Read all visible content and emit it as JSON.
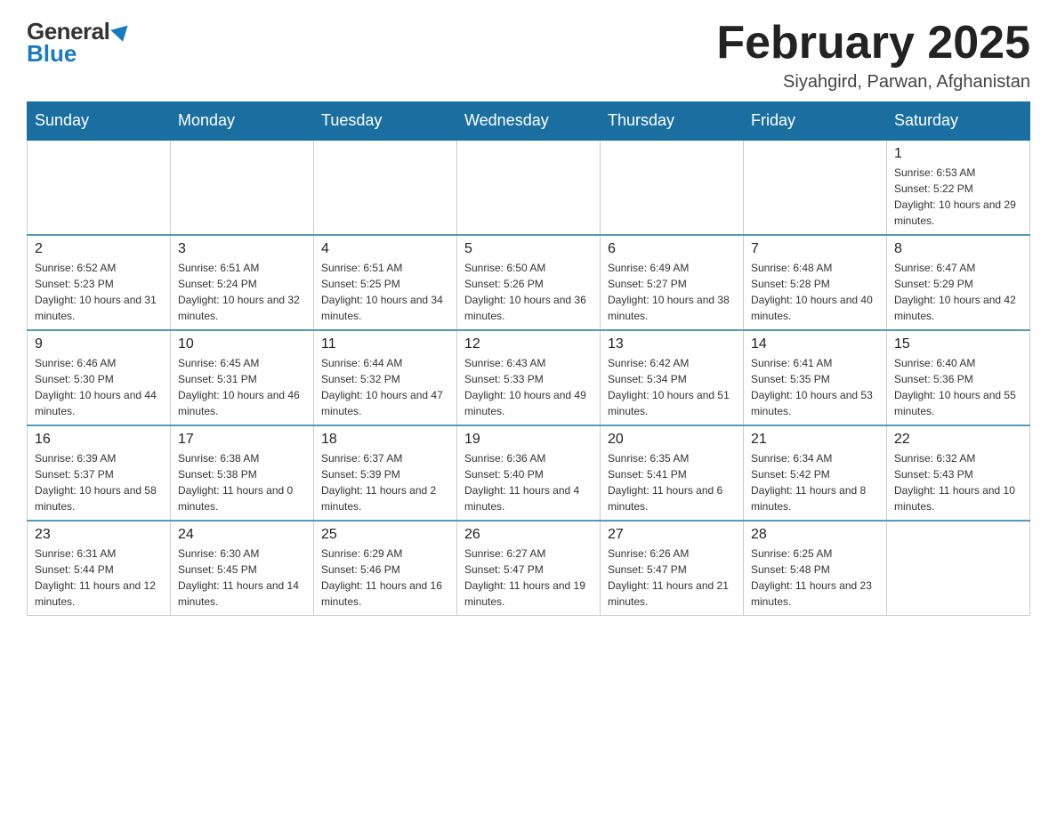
{
  "header": {
    "logo": {
      "general_text": "General",
      "blue_text": "Blue"
    },
    "title": "February 2025",
    "subtitle": "Siyahgird, Parwan, Afghanistan"
  },
  "calendar": {
    "weekdays": [
      "Sunday",
      "Monday",
      "Tuesday",
      "Wednesday",
      "Thursday",
      "Friday",
      "Saturday"
    ],
    "weeks": [
      [
        {
          "day": "",
          "sunrise": "",
          "sunset": "",
          "daylight": "",
          "empty": true
        },
        {
          "day": "",
          "sunrise": "",
          "sunset": "",
          "daylight": "",
          "empty": true
        },
        {
          "day": "",
          "sunrise": "",
          "sunset": "",
          "daylight": "",
          "empty": true
        },
        {
          "day": "",
          "sunrise": "",
          "sunset": "",
          "daylight": "",
          "empty": true
        },
        {
          "day": "",
          "sunrise": "",
          "sunset": "",
          "daylight": "",
          "empty": true
        },
        {
          "day": "",
          "sunrise": "",
          "sunset": "",
          "daylight": "",
          "empty": true
        },
        {
          "day": "1",
          "sunrise": "Sunrise: 6:53 AM",
          "sunset": "Sunset: 5:22 PM",
          "daylight": "Daylight: 10 hours and 29 minutes.",
          "empty": false
        }
      ],
      [
        {
          "day": "2",
          "sunrise": "Sunrise: 6:52 AM",
          "sunset": "Sunset: 5:23 PM",
          "daylight": "Daylight: 10 hours and 31 minutes.",
          "empty": false
        },
        {
          "day": "3",
          "sunrise": "Sunrise: 6:51 AM",
          "sunset": "Sunset: 5:24 PM",
          "daylight": "Daylight: 10 hours and 32 minutes.",
          "empty": false
        },
        {
          "day": "4",
          "sunrise": "Sunrise: 6:51 AM",
          "sunset": "Sunset: 5:25 PM",
          "daylight": "Daylight: 10 hours and 34 minutes.",
          "empty": false
        },
        {
          "day": "5",
          "sunrise": "Sunrise: 6:50 AM",
          "sunset": "Sunset: 5:26 PM",
          "daylight": "Daylight: 10 hours and 36 minutes.",
          "empty": false
        },
        {
          "day": "6",
          "sunrise": "Sunrise: 6:49 AM",
          "sunset": "Sunset: 5:27 PM",
          "daylight": "Daylight: 10 hours and 38 minutes.",
          "empty": false
        },
        {
          "day": "7",
          "sunrise": "Sunrise: 6:48 AM",
          "sunset": "Sunset: 5:28 PM",
          "daylight": "Daylight: 10 hours and 40 minutes.",
          "empty": false
        },
        {
          "day": "8",
          "sunrise": "Sunrise: 6:47 AM",
          "sunset": "Sunset: 5:29 PM",
          "daylight": "Daylight: 10 hours and 42 minutes.",
          "empty": false
        }
      ],
      [
        {
          "day": "9",
          "sunrise": "Sunrise: 6:46 AM",
          "sunset": "Sunset: 5:30 PM",
          "daylight": "Daylight: 10 hours and 44 minutes.",
          "empty": false
        },
        {
          "day": "10",
          "sunrise": "Sunrise: 6:45 AM",
          "sunset": "Sunset: 5:31 PM",
          "daylight": "Daylight: 10 hours and 46 minutes.",
          "empty": false
        },
        {
          "day": "11",
          "sunrise": "Sunrise: 6:44 AM",
          "sunset": "Sunset: 5:32 PM",
          "daylight": "Daylight: 10 hours and 47 minutes.",
          "empty": false
        },
        {
          "day": "12",
          "sunrise": "Sunrise: 6:43 AM",
          "sunset": "Sunset: 5:33 PM",
          "daylight": "Daylight: 10 hours and 49 minutes.",
          "empty": false
        },
        {
          "day": "13",
          "sunrise": "Sunrise: 6:42 AM",
          "sunset": "Sunset: 5:34 PM",
          "daylight": "Daylight: 10 hours and 51 minutes.",
          "empty": false
        },
        {
          "day": "14",
          "sunrise": "Sunrise: 6:41 AM",
          "sunset": "Sunset: 5:35 PM",
          "daylight": "Daylight: 10 hours and 53 minutes.",
          "empty": false
        },
        {
          "day": "15",
          "sunrise": "Sunrise: 6:40 AM",
          "sunset": "Sunset: 5:36 PM",
          "daylight": "Daylight: 10 hours and 55 minutes.",
          "empty": false
        }
      ],
      [
        {
          "day": "16",
          "sunrise": "Sunrise: 6:39 AM",
          "sunset": "Sunset: 5:37 PM",
          "daylight": "Daylight: 10 hours and 58 minutes.",
          "empty": false
        },
        {
          "day": "17",
          "sunrise": "Sunrise: 6:38 AM",
          "sunset": "Sunset: 5:38 PM",
          "daylight": "Daylight: 11 hours and 0 minutes.",
          "empty": false
        },
        {
          "day": "18",
          "sunrise": "Sunrise: 6:37 AM",
          "sunset": "Sunset: 5:39 PM",
          "daylight": "Daylight: 11 hours and 2 minutes.",
          "empty": false
        },
        {
          "day": "19",
          "sunrise": "Sunrise: 6:36 AM",
          "sunset": "Sunset: 5:40 PM",
          "daylight": "Daylight: 11 hours and 4 minutes.",
          "empty": false
        },
        {
          "day": "20",
          "sunrise": "Sunrise: 6:35 AM",
          "sunset": "Sunset: 5:41 PM",
          "daylight": "Daylight: 11 hours and 6 minutes.",
          "empty": false
        },
        {
          "day": "21",
          "sunrise": "Sunrise: 6:34 AM",
          "sunset": "Sunset: 5:42 PM",
          "daylight": "Daylight: 11 hours and 8 minutes.",
          "empty": false
        },
        {
          "day": "22",
          "sunrise": "Sunrise: 6:32 AM",
          "sunset": "Sunset: 5:43 PM",
          "daylight": "Daylight: 11 hours and 10 minutes.",
          "empty": false
        }
      ],
      [
        {
          "day": "23",
          "sunrise": "Sunrise: 6:31 AM",
          "sunset": "Sunset: 5:44 PM",
          "daylight": "Daylight: 11 hours and 12 minutes.",
          "empty": false
        },
        {
          "day": "24",
          "sunrise": "Sunrise: 6:30 AM",
          "sunset": "Sunset: 5:45 PM",
          "daylight": "Daylight: 11 hours and 14 minutes.",
          "empty": false
        },
        {
          "day": "25",
          "sunrise": "Sunrise: 6:29 AM",
          "sunset": "Sunset: 5:46 PM",
          "daylight": "Daylight: 11 hours and 16 minutes.",
          "empty": false
        },
        {
          "day": "26",
          "sunrise": "Sunrise: 6:27 AM",
          "sunset": "Sunset: 5:47 PM",
          "daylight": "Daylight: 11 hours and 19 minutes.",
          "empty": false
        },
        {
          "day": "27",
          "sunrise": "Sunrise: 6:26 AM",
          "sunset": "Sunset: 5:47 PM",
          "daylight": "Daylight: 11 hours and 21 minutes.",
          "empty": false
        },
        {
          "day": "28",
          "sunrise": "Sunrise: 6:25 AM",
          "sunset": "Sunset: 5:48 PM",
          "daylight": "Daylight: 11 hours and 23 minutes.",
          "empty": false
        },
        {
          "day": "",
          "sunrise": "",
          "sunset": "",
          "daylight": "",
          "empty": true
        }
      ]
    ]
  }
}
